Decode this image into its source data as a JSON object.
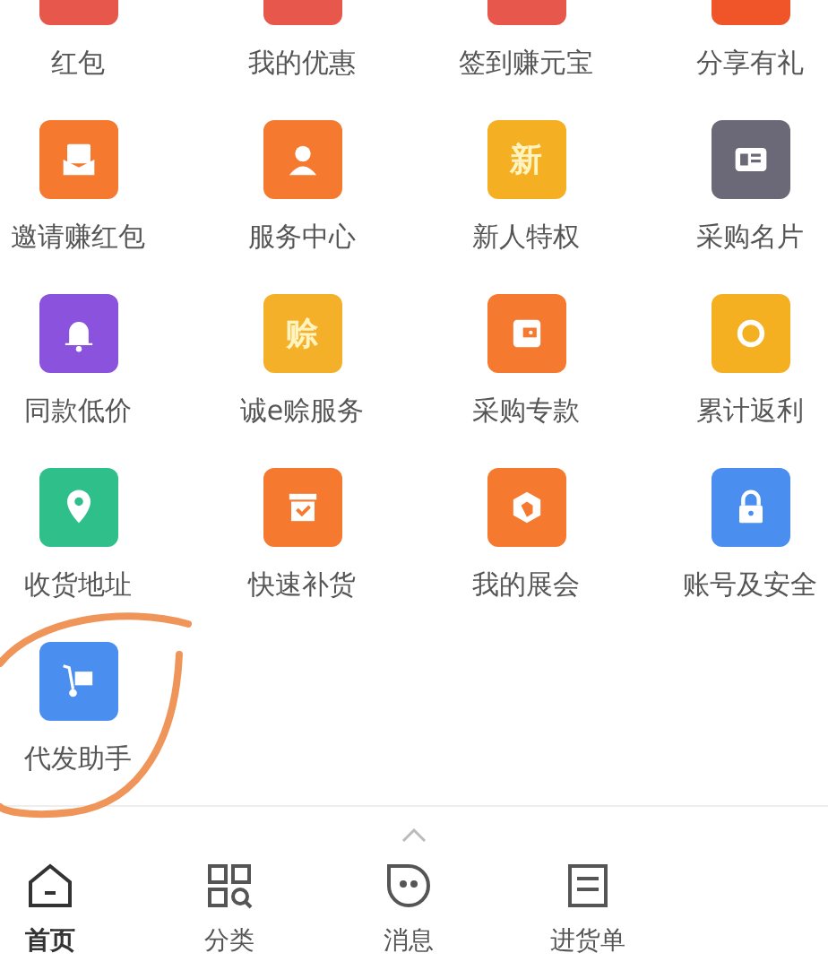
{
  "grid": [
    {
      "label": "红包",
      "color": "#e8574c",
      "cut": true
    },
    {
      "label": "我的优惠",
      "color": "#e8574c",
      "cut": true
    },
    {
      "label": "签到赚元宝",
      "color": "#e8574c",
      "cut": true
    },
    {
      "label": "分享有礼",
      "color": "#f0552a",
      "cut": true
    },
    {
      "label": "邀请赚红包",
      "color": "#f5792e",
      "cut": false
    },
    {
      "label": "服务中心",
      "color": "#f5792e",
      "cut": false
    },
    {
      "label": "新人特权",
      "color": "#f5af22",
      "cut": false,
      "glyph": "新"
    },
    {
      "label": "采购名片",
      "color": "#6b6878",
      "cut": false
    },
    {
      "label": "同款低价",
      "color": "#8a52dd",
      "cut": false
    },
    {
      "label": "诚e赊服务",
      "color": "#f5b02a",
      "cut": false,
      "glyph": "赊"
    },
    {
      "label": "采购专款",
      "color": "#f5792e",
      "cut": false
    },
    {
      "label": "累计返利",
      "color": "#f5b022",
      "cut": false
    },
    {
      "label": "收货地址",
      "color": "#2fbf8a",
      "cut": false
    },
    {
      "label": "快速补货",
      "color": "#f5792e",
      "cut": false
    },
    {
      "label": "我的展会",
      "color": "#f5792e",
      "cut": false
    },
    {
      "label": "账号及安全",
      "color": "#4a8ef0",
      "cut": false
    },
    {
      "label": "代发助手",
      "color": "#4a8ef0",
      "cut": false
    }
  ],
  "tab_bar": [
    {
      "label": "首页",
      "selected": true
    },
    {
      "label": "分类",
      "selected": false
    },
    {
      "label": "消息",
      "selected": false
    },
    {
      "label": "进货单",
      "selected": false
    }
  ]
}
